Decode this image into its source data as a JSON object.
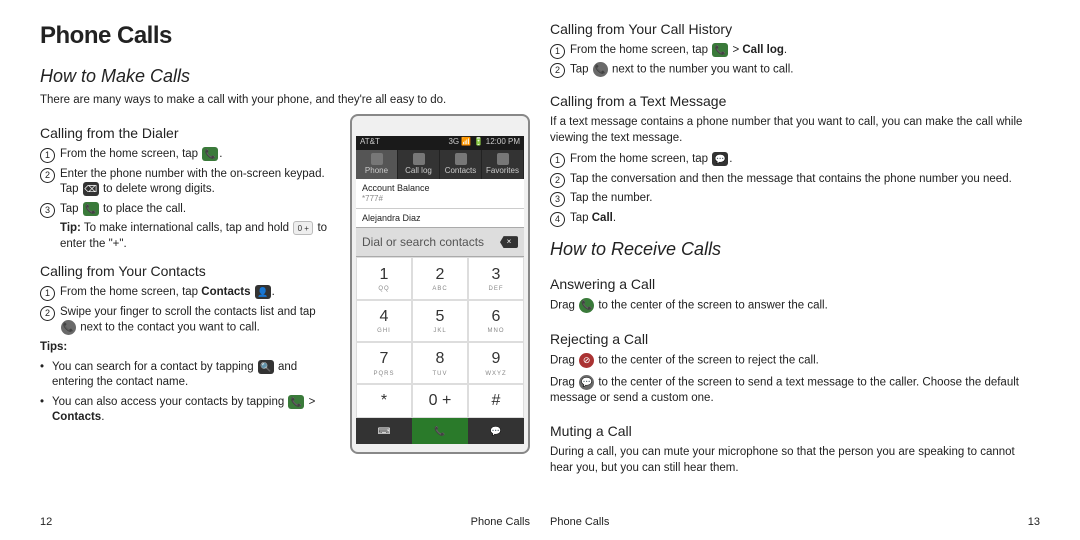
{
  "left": {
    "title": "Phone Calls",
    "section": "How to Make Calls",
    "intro": "There are many ways to make a call with your phone, and they're all easy to do.",
    "dialer": {
      "heading": "Calling from the Dialer",
      "s1a": "From the home screen, tap ",
      "s1b": ".",
      "s2a": "Enter the phone number with the on-screen keypad. Tap ",
      "s2b": " to delete wrong digits.",
      "s3a": "Tap ",
      "s3b": " to place the call.",
      "tipLabel": "Tip:",
      "tipA": " To make international calls, tap and hold ",
      "tipKey": "0 +",
      "tipB": " to enter the \"+\"."
    },
    "contacts": {
      "heading": "Calling from Your Contacts",
      "s1a": "From the home screen, tap ",
      "s1bold": "Contacts",
      "s1b": " ",
      "s1c": ".",
      "s2a": "Swipe your finger to scroll the contacts list and tap ",
      "s2b": " next to the contact you want to call.",
      "tipsLabel": "Tips:",
      "b1a": "You can search for a contact by tapping ",
      "b1b": " and entering the contact name.",
      "b2a": "You can also access your contacts by tapping ",
      "b2sep": " > ",
      "b2bold": "Contacts",
      "b2b": "."
    },
    "pageNum": "12",
    "footerText": "Phone Calls"
  },
  "phone": {
    "carrier": "AT&T",
    "time": "12:00 PM",
    "tabs": [
      "Phone",
      "Call log",
      "Contacts",
      "Favorites"
    ],
    "acctTitle": "Account Balance",
    "acctSub": "*777#",
    "contactName": "Alejandra Diaz",
    "searchPH": "Dial or search contacts",
    "keys": [
      {
        "d": "1",
        "l": "QQ"
      },
      {
        "d": "2",
        "l": "ABC"
      },
      {
        "d": "3",
        "l": "DEF"
      },
      {
        "d": "4",
        "l": "GHI"
      },
      {
        "d": "5",
        "l": "JKL"
      },
      {
        "d": "6",
        "l": "MNO"
      },
      {
        "d": "7",
        "l": "PQRS"
      },
      {
        "d": "8",
        "l": "TUV"
      },
      {
        "d": "9",
        "l": "WXYZ"
      },
      {
        "d": "*",
        "l": ""
      },
      {
        "d": "0 +",
        "l": ""
      },
      {
        "d": "#",
        "l": ""
      }
    ]
  },
  "right": {
    "history": {
      "heading": "Calling from Your Call History",
      "s1a": "From the home screen, tap ",
      "s1sep": " > ",
      "s1bold": "Call log",
      "s1b": ".",
      "s2a": "Tap ",
      "s2b": " next to the number you want to call."
    },
    "textmsg": {
      "heading": "Calling from a Text Message",
      "intro": "If a text message contains a phone number that you want to call, you can make the call while viewing the text message.",
      "s1a": "From the home screen, tap ",
      "s1b": ".",
      "s2": "Tap the conversation and then the message that contains the phone number you need.",
      "s3": "Tap the number.",
      "s4a": "Tap ",
      "s4bold": "Call",
      "s4b": "."
    },
    "receive": {
      "section": "How to Receive Calls",
      "answer": {
        "heading": "Answering a Call",
        "a": "Drag ",
        "b": " to the center of the screen to answer the call."
      },
      "reject": {
        "heading": "Rejecting a Call",
        "a1": "Drag ",
        "b1": " to the center of the screen to reject the call.",
        "a2": "Drag ",
        "b2": " to the center of the screen to send a text message to the caller. Choose the default message or send a custom one."
      },
      "mute": {
        "heading": "Muting a Call",
        "text": "During a call, you can mute your microphone so that the person you are speaking to cannot hear you, but you can still hear them."
      }
    },
    "pageNum": "13",
    "footerText": "Phone Calls"
  }
}
